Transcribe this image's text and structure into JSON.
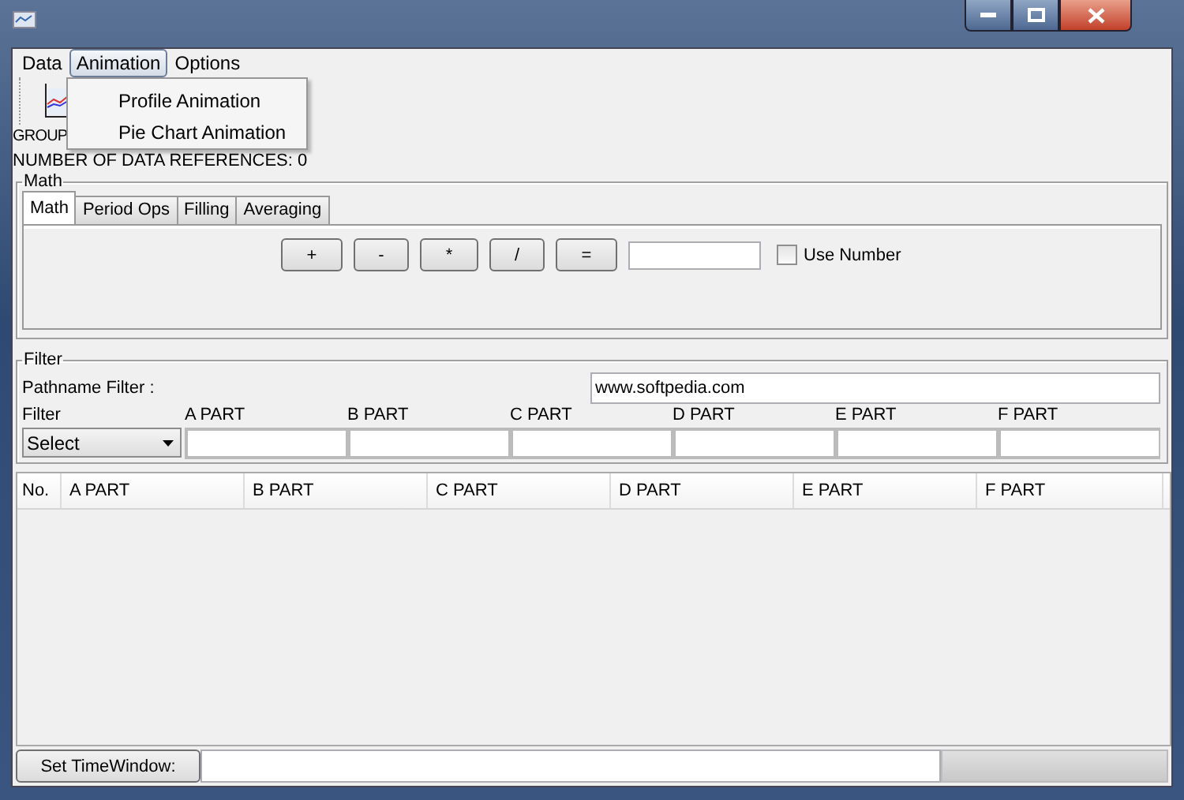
{
  "menu": [
    {
      "label": "Data",
      "selected": false
    },
    {
      "label": "Animation",
      "selected": true
    },
    {
      "label": "Options",
      "selected": false
    }
  ],
  "open_menu": {
    "items": [
      "Profile Animation",
      "Pie Chart Animation"
    ]
  },
  "toolbar_label": "GROUP",
  "data_references": "NUMBER OF DATA REFERENCES: 0",
  "math": {
    "title": "Math",
    "tabs": [
      {
        "label": "Math",
        "selected": true
      },
      {
        "label": "Period Ops",
        "selected": false
      },
      {
        "label": "Filling",
        "selected": false
      },
      {
        "label": "Averaging",
        "selected": false
      }
    ],
    "operators": [
      "+",
      "-",
      "*",
      "/",
      "="
    ],
    "use_number": {
      "label": "Use Number",
      "checked": false
    }
  },
  "filter": {
    "title": "Filter",
    "pathname_label": "Pathname Filter :",
    "pathname_value": "www.softpedia.com",
    "filter_label": "Filter",
    "select": "Select",
    "parts": [
      "A PART",
      "B PART",
      "C PART",
      "D PART",
      "E PART",
      "F PART"
    ]
  },
  "table": {
    "columns": [
      "No.",
      "A PART",
      "B PART",
      "C PART",
      "D PART",
      "E PART",
      "F PART"
    ]
  },
  "time_window": {
    "button": "Set TimeWindow:"
  }
}
